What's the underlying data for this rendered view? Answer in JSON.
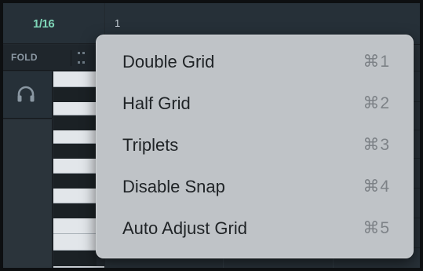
{
  "header": {
    "grid_size": "1/16",
    "ruler_marker": "1",
    "fold_label": "FOLD"
  },
  "icons": {
    "headphones": "headphones-icon",
    "fold_toggle": "expand-icon"
  },
  "colors": {
    "grid_size_text": "#7fd6b8",
    "menu_background": "#bfc3c7",
    "panel_background": "#22292f"
  },
  "menu": {
    "items": [
      {
        "label": "Double Grid",
        "shortcut": "⌘1"
      },
      {
        "label": "Half Grid",
        "shortcut": "⌘2"
      },
      {
        "label": "Triplets",
        "shortcut": "⌘3"
      },
      {
        "label": "Disable Snap",
        "shortcut": "⌘4"
      },
      {
        "label": "Auto Adjust Grid",
        "shortcut": "⌘5"
      }
    ]
  }
}
